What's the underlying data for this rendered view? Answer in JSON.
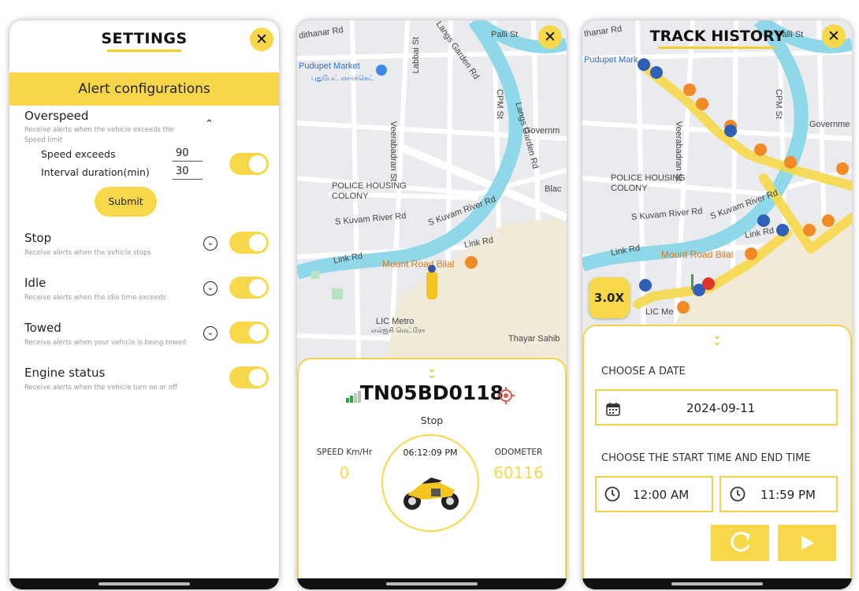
{
  "settings": {
    "title": "SETTINGS",
    "banner": "Alert configurations",
    "overspeed": {
      "title": "Overspeed",
      "subtitle": "Receive alerts when the vehicle exceeds the Speed limit",
      "speed_label": "Speed exceeds",
      "speed_value": "90",
      "interval_label": "Interval duration(min)",
      "interval_value": "30",
      "submit": "Submit",
      "enabled": true
    },
    "stop": {
      "title": "Stop",
      "subtitle": "Receive alerts when the vehicle stops",
      "enabled": true
    },
    "idle": {
      "title": "Idle",
      "subtitle": "Receive alerts when the idle time exceeds",
      "enabled": true
    },
    "towed": {
      "title": "Towed",
      "subtitle": "Receive alerts when your vehicle is being towed",
      "enabled": true
    },
    "engine": {
      "title": "Engine status",
      "subtitle": "Receive alerts when the vehicle turn on or off",
      "enabled": true
    }
  },
  "map_labels": {
    "pudupet": "Pudupet Market",
    "pudupet_tamil": "புதுபேட் மார்க்கெட்",
    "police": "POLICE HOUSING",
    "colony": "COLONY",
    "kuvam1": "S Kuvam River Rd",
    "kuvam2": "S Kuvam River Rd",
    "link1": "Link Rd",
    "link2": "Link Rd",
    "mount_road": "Mount Road Bilal",
    "lic": "LIC Metro",
    "lic_tamil": "எல்ஐசி மெட்ரோ",
    "thayar": "Thayar Sahib",
    "govern": "Governm",
    "dithanar": "dithanar Rd",
    "langs": "Langs Garden Rd",
    "langs2": "Langs Garden Rd",
    "lambai": "Labbai St",
    "veera": "Veerabadran St",
    "cpm": "CPM St",
    "palli": "Palli St",
    "black": "Blac"
  },
  "tracking": {
    "plate": "TN05BD0118",
    "status": "Stop",
    "speed_label": "SPEED Km/Hr",
    "speed_value": "0",
    "time": "06:12:09 PM",
    "odometer_label": "ODOMETER",
    "odometer_value": "60116",
    "accent": "#f6d84a"
  },
  "history": {
    "title": "TRACK HISTORY",
    "speed_multiplier": "3.0X",
    "date_label": "CHOOSE A DATE",
    "date_value": "2024-09-11",
    "time_label": "CHOOSE THE START TIME AND END TIME",
    "start_time": "12:00 AM",
    "end_time": "11:59 PM",
    "map_labels": {
      "pudupet": "Pudupet Mark",
      "police": "POLICE HOUSING",
      "colony": "COLONY",
      "kuvam1": "S Kuvam River Rd",
      "kuvam2": "S Kuvam River Rd",
      "link1": "Link Rd",
      "link2": "Link Rd",
      "mount": "Mount Road Bilal",
      "lic": "LIC Me",
      "govern": "Governme",
      "thanar": "thanar Rd",
      "palli": "Palli St",
      "cpm": "CPM St",
      "veera": "Veerabadran St"
    }
  }
}
